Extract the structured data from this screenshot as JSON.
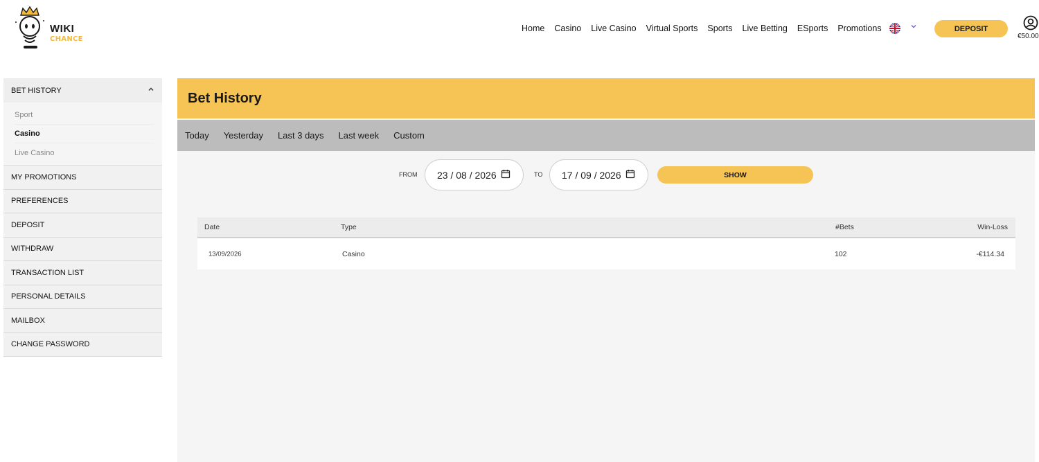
{
  "header": {
    "logo_word1": "WIKI",
    "logo_word2": "CHANCE",
    "nav": [
      "Home",
      "Casino",
      "Live Casino",
      "Virtual Sports",
      "Sports",
      "Live Betting",
      "ESports",
      "Promotions"
    ],
    "language_icon": "uk-flag-icon",
    "deposit_label": "DEPOSIT",
    "balance": "€50.00"
  },
  "sidebar": {
    "section_title": "BET HISTORY",
    "sub_items": [
      {
        "label": "Sport",
        "active": false
      },
      {
        "label": "Casino",
        "active": true
      },
      {
        "label": "Live Casino",
        "active": false
      }
    ],
    "items": [
      "MY PROMOTIONS",
      "PREFERENCES",
      "DEPOSIT",
      "WITHDRAW",
      "TRANSACTION LIST",
      "PERSONAL DETAILS",
      "MAILBOX",
      "CHANGE PASSWORD"
    ]
  },
  "main": {
    "title": "Bet History",
    "tabs": [
      "Today",
      "Yesterday",
      "Last 3 days",
      "Last week",
      "Custom"
    ],
    "from_label": "FROM",
    "from_date": "23 / 08 / 2026",
    "to_label": "TO",
    "to_date": "17 / 09 / 2026",
    "show_label": "SHOW",
    "table": {
      "headers": [
        "Date",
        "Type",
        "#Bets",
        "Win-Loss"
      ],
      "rows": [
        [
          "13/09/2026",
          "Casino",
          "102",
          "-€114.34"
        ]
      ]
    }
  },
  "colors": {
    "accent": "#f5c454",
    "tab_bar": "#bcbcbc",
    "panel_bg": "#f5f5f5"
  }
}
